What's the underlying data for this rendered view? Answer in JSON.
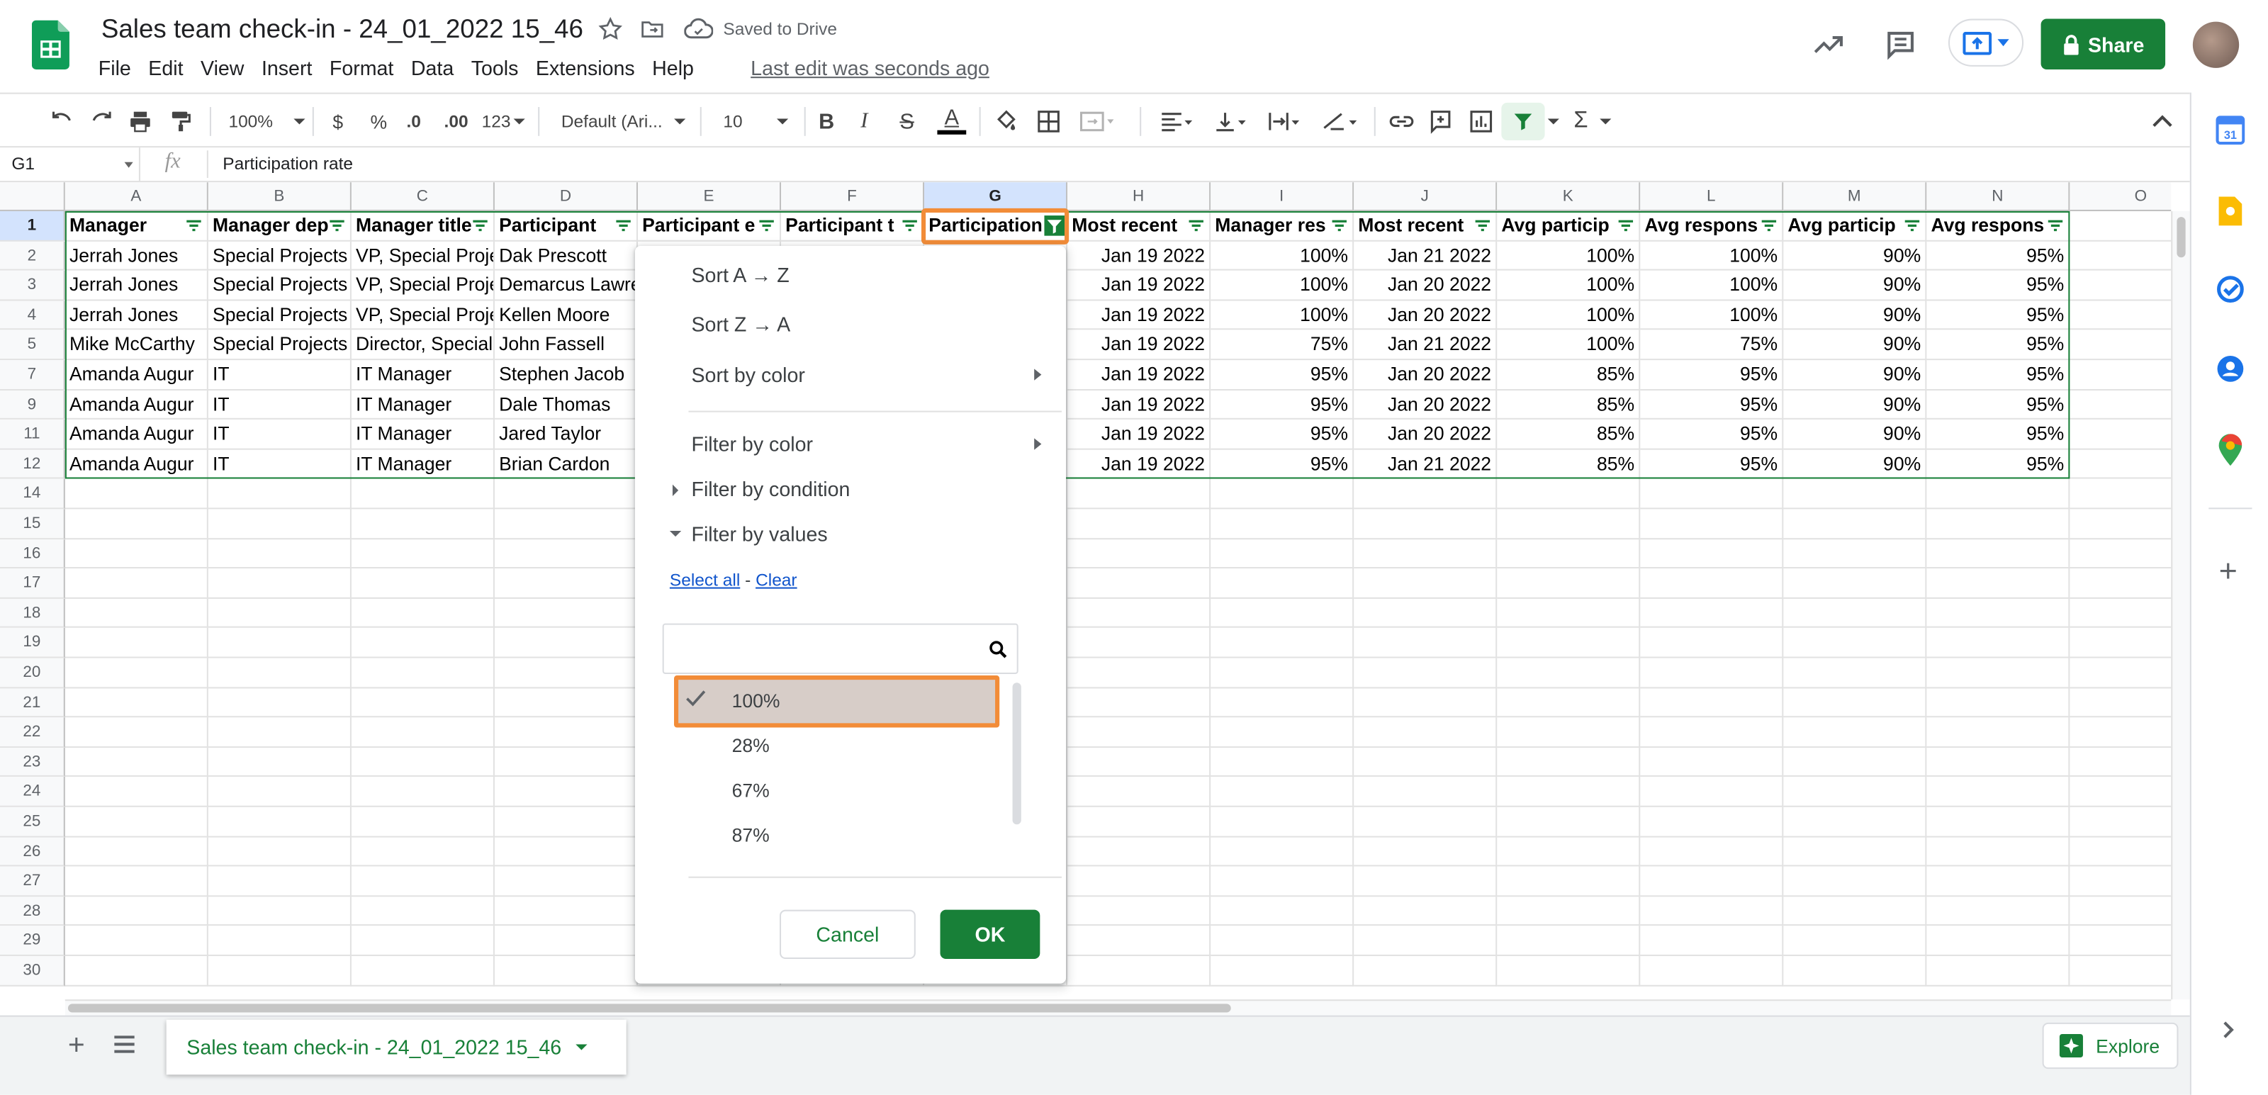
{
  "doc": {
    "title": "Sales team check-in - 24_01_2022 15_46",
    "saved_status": "Saved to Drive",
    "last_edit": "Last edit was seconds ago"
  },
  "menu": [
    "File",
    "Edit",
    "View",
    "Insert",
    "Format",
    "Data",
    "Tools",
    "Extensions",
    "Help"
  ],
  "header_buttons": {
    "share": "Share"
  },
  "toolbar": {
    "zoom": "100%",
    "currency": "$",
    "percent": "%",
    "dec_less": ".0",
    "dec_more": ".00",
    "format_more": "123",
    "font": "Default (Ari...",
    "font_size": "10"
  },
  "formula_bar": {
    "cell_ref": "G1",
    "fx": "fx",
    "value": "Participation rate"
  },
  "columns": [
    "A",
    "B",
    "C",
    "D",
    "E",
    "F",
    "G",
    "H",
    "I",
    "J",
    "K",
    "L",
    "M",
    "N",
    "O"
  ],
  "row_numbers": [
    "1",
    "2",
    "3",
    "4",
    "5",
    "7",
    "9",
    "11",
    "12",
    "14",
    "15",
    "16",
    "17",
    "18",
    "19",
    "20",
    "21",
    "22",
    "23",
    "24",
    "25",
    "26",
    "27",
    "28",
    "29",
    "30"
  ],
  "headers": [
    "Manager",
    "Manager dep",
    "Manager title",
    "Participant",
    "Participant e",
    "Participant t",
    "Participation",
    "Most recent",
    "Manager res",
    "Most recent",
    "Avg particip",
    "Avg respons",
    "Avg particip",
    "Avg respons"
  ],
  "rows": [
    [
      "Jerrah Jones",
      "Special Projects",
      "VP, Special Proje",
      "Dak Prescott",
      "",
      "",
      "",
      "Jan 19 2022",
      "100%",
      "Jan 21 2022",
      "100%",
      "100%",
      "90%",
      "95%"
    ],
    [
      "Jerrah Jones",
      "Special Projects",
      "VP, Special Proje",
      "Demarcus Lawre",
      "",
      "",
      "",
      "Jan 19 2022",
      "100%",
      "Jan 20 2022",
      "100%",
      "100%",
      "90%",
      "95%"
    ],
    [
      "Jerrah Jones",
      "Special Projects",
      "VP, Special Proje",
      "Kellen Moore",
      "",
      "",
      "",
      "Jan 19 2022",
      "100%",
      "Jan 20 2022",
      "100%",
      "100%",
      "90%",
      "95%"
    ],
    [
      "Mike McCarthy",
      "Special Projects",
      "Director, Special",
      "John Fassell",
      "",
      "",
      "",
      "Jan 19 2022",
      "75%",
      "Jan 21 2022",
      "100%",
      "75%",
      "90%",
      "95%"
    ],
    [
      "Amanda Augur",
      "IT",
      "IT Manager",
      "Stephen Jacob",
      "",
      "",
      "",
      "Jan 19 2022",
      "95%",
      "Jan 20 2022",
      "85%",
      "95%",
      "90%",
      "95%"
    ],
    [
      "Amanda Augur",
      "IT",
      "IT Manager",
      "Dale Thomas",
      "",
      "",
      "",
      "Jan 19 2022",
      "95%",
      "Jan 20 2022",
      "85%",
      "95%",
      "90%",
      "95%"
    ],
    [
      "Amanda Augur",
      "IT",
      "IT Manager",
      "Jared Taylor",
      "",
      "",
      "",
      "Jan 19 2022",
      "95%",
      "Jan 20 2022",
      "85%",
      "95%",
      "90%",
      "95%"
    ],
    [
      "Amanda Augur",
      "IT",
      "IT Manager",
      "Brian Cardon",
      "",
      "",
      "",
      "Jan 19 2022",
      "95%",
      "Jan 21 2022",
      "85%",
      "95%",
      "90%",
      "95%"
    ]
  ],
  "filter_menu": {
    "sort_az": "Sort A → Z",
    "sort_za": "Sort Z → A",
    "sort_color": "Sort by color",
    "filter_color": "Filter by color",
    "filter_condition": "Filter by condition",
    "filter_values": "Filter by values",
    "select_all": "Select all",
    "dash": " - ",
    "clear": "Clear",
    "search_placeholder": "",
    "values": [
      {
        "label": "100%",
        "checked": true
      },
      {
        "label": "28%",
        "checked": false
      },
      {
        "label": "67%",
        "checked": false
      },
      {
        "label": "87%",
        "checked": false
      }
    ],
    "cancel": "Cancel",
    "ok": "OK"
  },
  "sheet_tab": "Sales team check-in - 24_01_2022 15_46",
  "explore": "Explore",
  "colors": {
    "green": "#188038",
    "highlight": "#f28c38",
    "selected_bg": "#d7cdc8"
  }
}
